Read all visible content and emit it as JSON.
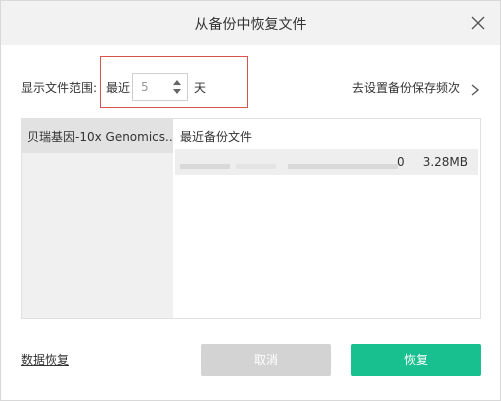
{
  "dialog": {
    "title": "从备份中恢复文件",
    "close_icon": "close-icon"
  },
  "range": {
    "label": "显示文件范围:",
    "recent_label": "最近",
    "value": "5",
    "unit": "天",
    "stepper_icons": [
      "chevron-up-icon",
      "chevron-down-icon"
    ]
  },
  "settings_link": {
    "label": "去设置备份保存频次",
    "icon": "chevron-right-icon"
  },
  "list": {
    "left_items": [
      {
        "label": "贝瑞基因-10x Genomics..."
      }
    ],
    "right_header": "最近备份文件",
    "files": [
      {
        "name": "",
        "suffix": "0",
        "size": "3.28MB"
      }
    ]
  },
  "footer": {
    "restore_link": "数据恢复",
    "cancel_label": "取消",
    "confirm_label": "恢复"
  },
  "colors": {
    "accent": "#19c08f",
    "disabled": "#d3d3d3",
    "highlight": "#d9534f"
  }
}
